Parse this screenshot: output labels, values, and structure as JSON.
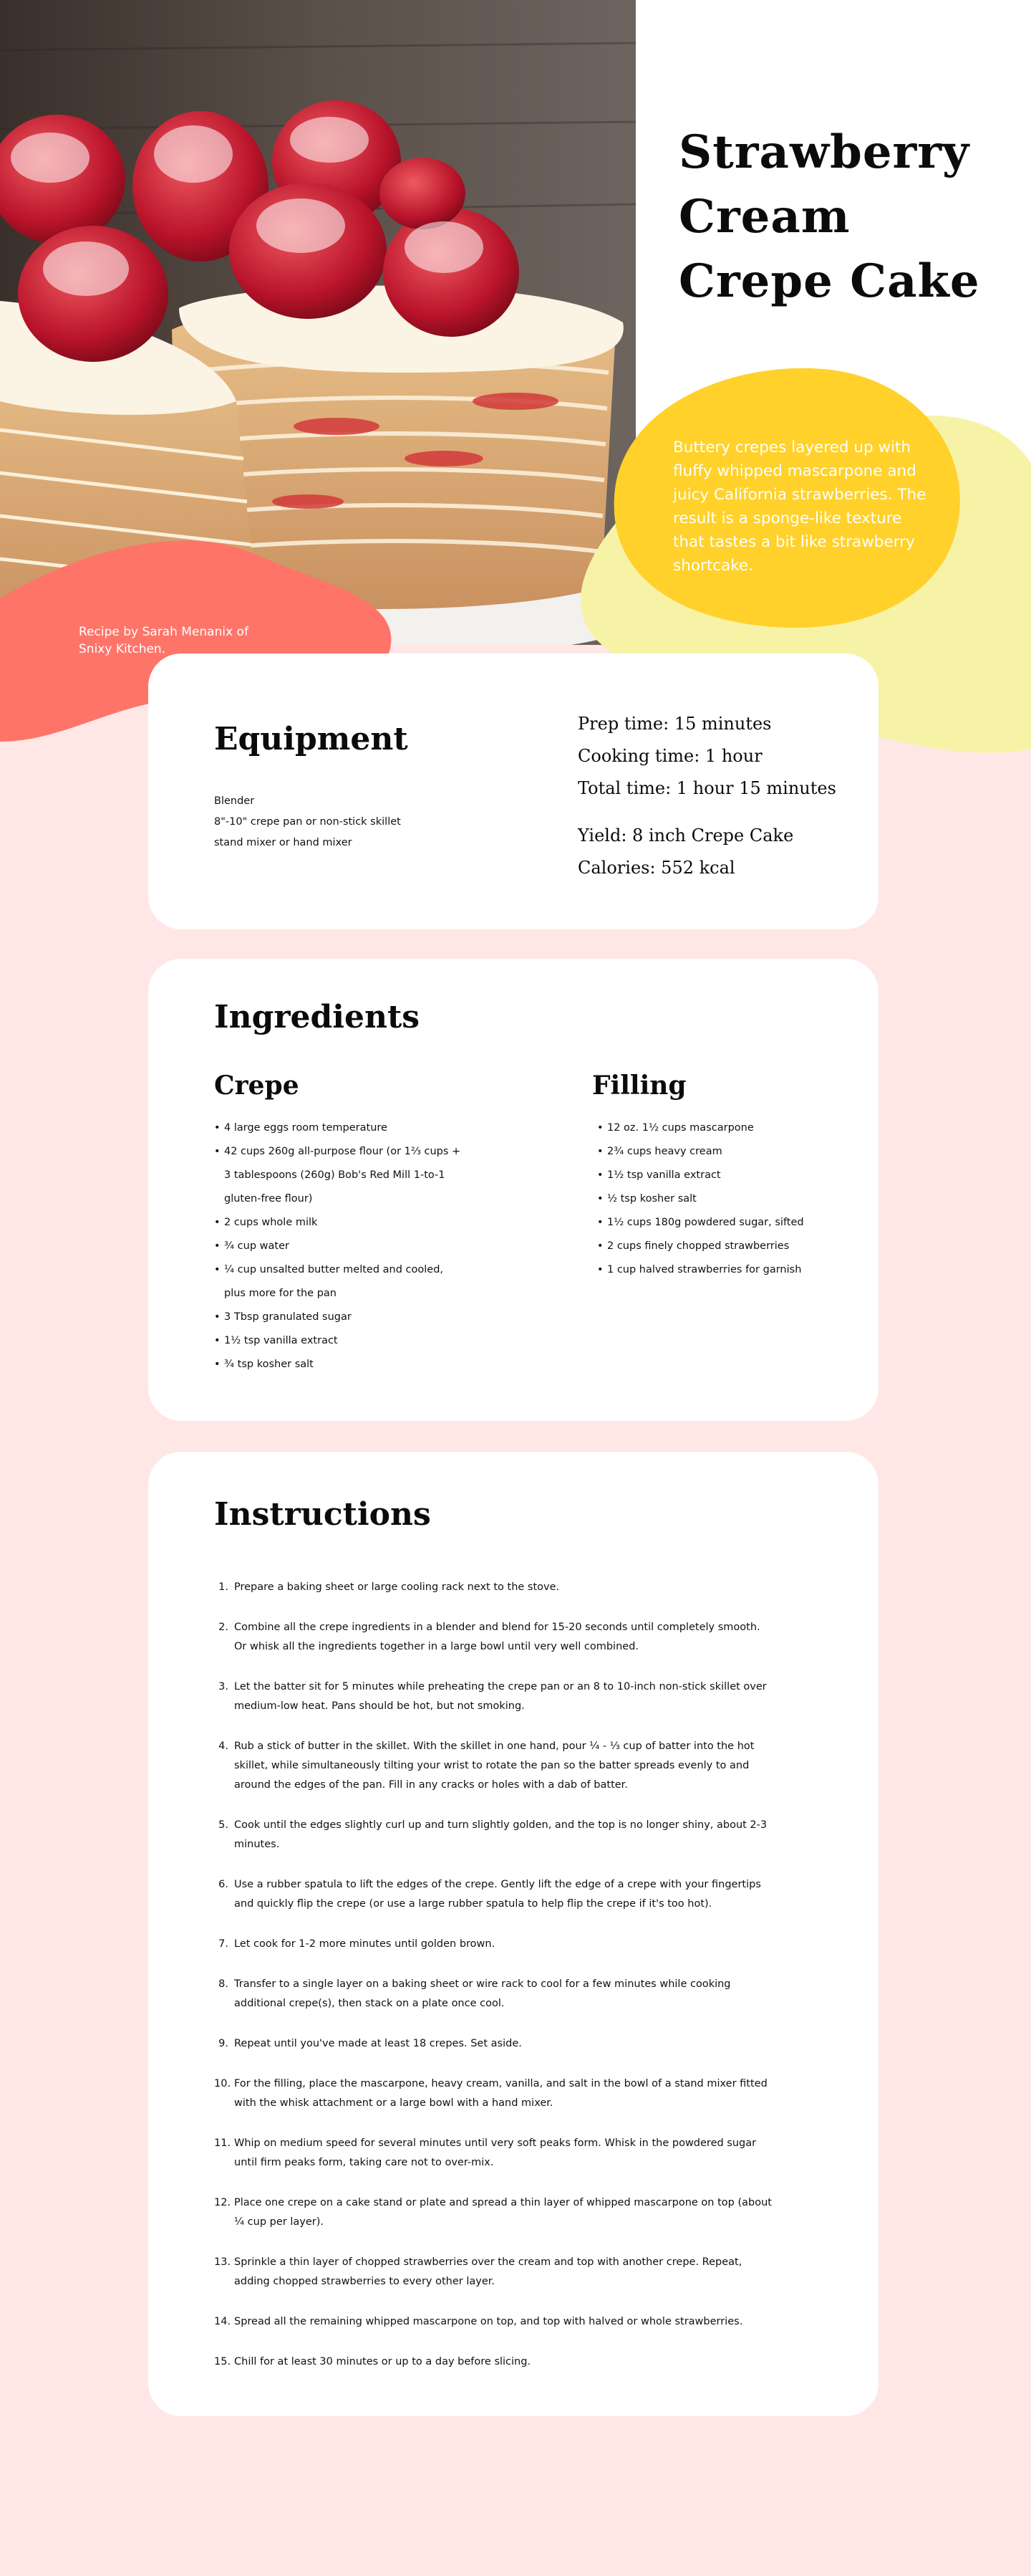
{
  "hero": {
    "title_lines": [
      "Strawberry",
      "Cream",
      "Crepe Cake"
    ],
    "description": "Buttery crepes layered up with fluffy whipped mascarpone and juicy California strawberries. The result is a sponge-like texture that tastes a bit like strawberry shortcake.",
    "credit": "Recipe by Sarah Menanix of Snixy Kitchen."
  },
  "equipment": {
    "heading": "Equipment",
    "items": [
      "Blender",
      "8\"-10\" crepe pan or non-stick skillet",
      "stand mixer or hand mixer"
    ],
    "prep_time": "Prep time: 15 minutes",
    "cooking_time": "Cooking time: 1 hour",
    "total_time": "Total time: 1 hour 15 minutes",
    "yield": "Yield: 8 inch Crepe Cake",
    "calories": "Calories: 552 kcal"
  },
  "ingredients": {
    "heading": "Ingredients",
    "crepe_heading": "Crepe",
    "crepe": [
      "4 large eggs room temperature",
      "42 cups 260g all-purpose flour (or 1⅔ cups + 3 tablespoons (260g) Bob's Red Mill 1-to-1 gluten-free flour)",
      "2 cups whole milk",
      "¾ cup water",
      "¼ cup unsalted butter melted and cooled, plus more for the pan",
      "3 Tbsp granulated sugar",
      "1½ tsp vanilla extract",
      "¾ tsp kosher salt"
    ],
    "filling_heading": "Filling",
    "filling": [
      "12 oz. 1½ cups mascarpone",
      "2¾ cups heavy cream",
      "1½ tsp vanilla extract",
      "½ tsp kosher salt",
      "1½ cups 180g powdered sugar, sifted",
      "2 cups finely chopped strawberries",
      "1 cup halved strawberries for garnish"
    ]
  },
  "instructions": {
    "heading": "Instructions",
    "steps": [
      "Prepare a baking sheet or large cooling rack next to the stove.",
      "Combine all the crepe ingredients in a blender and blend for 15-20 seconds until completely smooth. Or whisk all the ingredients together in a large bowl until very well combined.",
      "Let the batter sit for 5 minutes while preheating the crepe pan or an 8 to 10-inch non-stick skillet over medium-low heat. Pans should be hot, but not smoking.",
      "Rub a stick of butter in the skillet. With the skillet in one hand, pour ¼ - ⅓ cup of batter into the hot skillet, while simultaneously tilting your wrist to rotate the pan so the batter spreads evenly to and around the edges of the pan. Fill in any cracks or holes with a dab of batter.",
      "Cook until the edges slightly curl up and turn slightly golden, and the top is no longer shiny, about 2-3 minutes.",
      "Use a rubber spatula to lift the edges of the crepe. Gently lift the edge of a crepe with your fingertips and quickly flip the crepe (or use a large rubber spatula to help flip the crepe if it's too hot).",
      "Let cook for 1-2 more minutes until golden brown.",
      "Transfer to a single layer on a baking sheet or wire rack to cool for a few minutes while cooking additional crepe(s), then stack on a plate once cool.",
      "Repeat until you've made at least 18 crepes. Set aside.",
      "For the filling, place the mascarpone, heavy cream, vanilla, and salt in the bowl of a stand mixer fitted with the whisk attachment or a large bowl with a hand mixer.",
      "Whip on medium speed for several minutes until very soft peaks form. Whisk in the powdered sugar until firm peaks form, taking care not to over-mix.",
      "Place one crepe on a cake stand or plate and spread a thin layer of whipped mascarpone on top (about ¼ cup per layer).",
      "Sprinkle a thin layer of chopped strawberries over the cream and top with another crepe. Repeat, adding chopped strawberries to every other layer.",
      "Spread all the remaining whipped mascarpone on top, and top with halved or whole strawberries.",
      "Chill for at least 30 minutes or up to a day before slicing."
    ]
  },
  "colors": {
    "page_bg": "#ffe7e6",
    "yellow_blob": "#ffd12a",
    "pale_blob": "#f7f3a6",
    "red_blob": "#ff7469"
  }
}
